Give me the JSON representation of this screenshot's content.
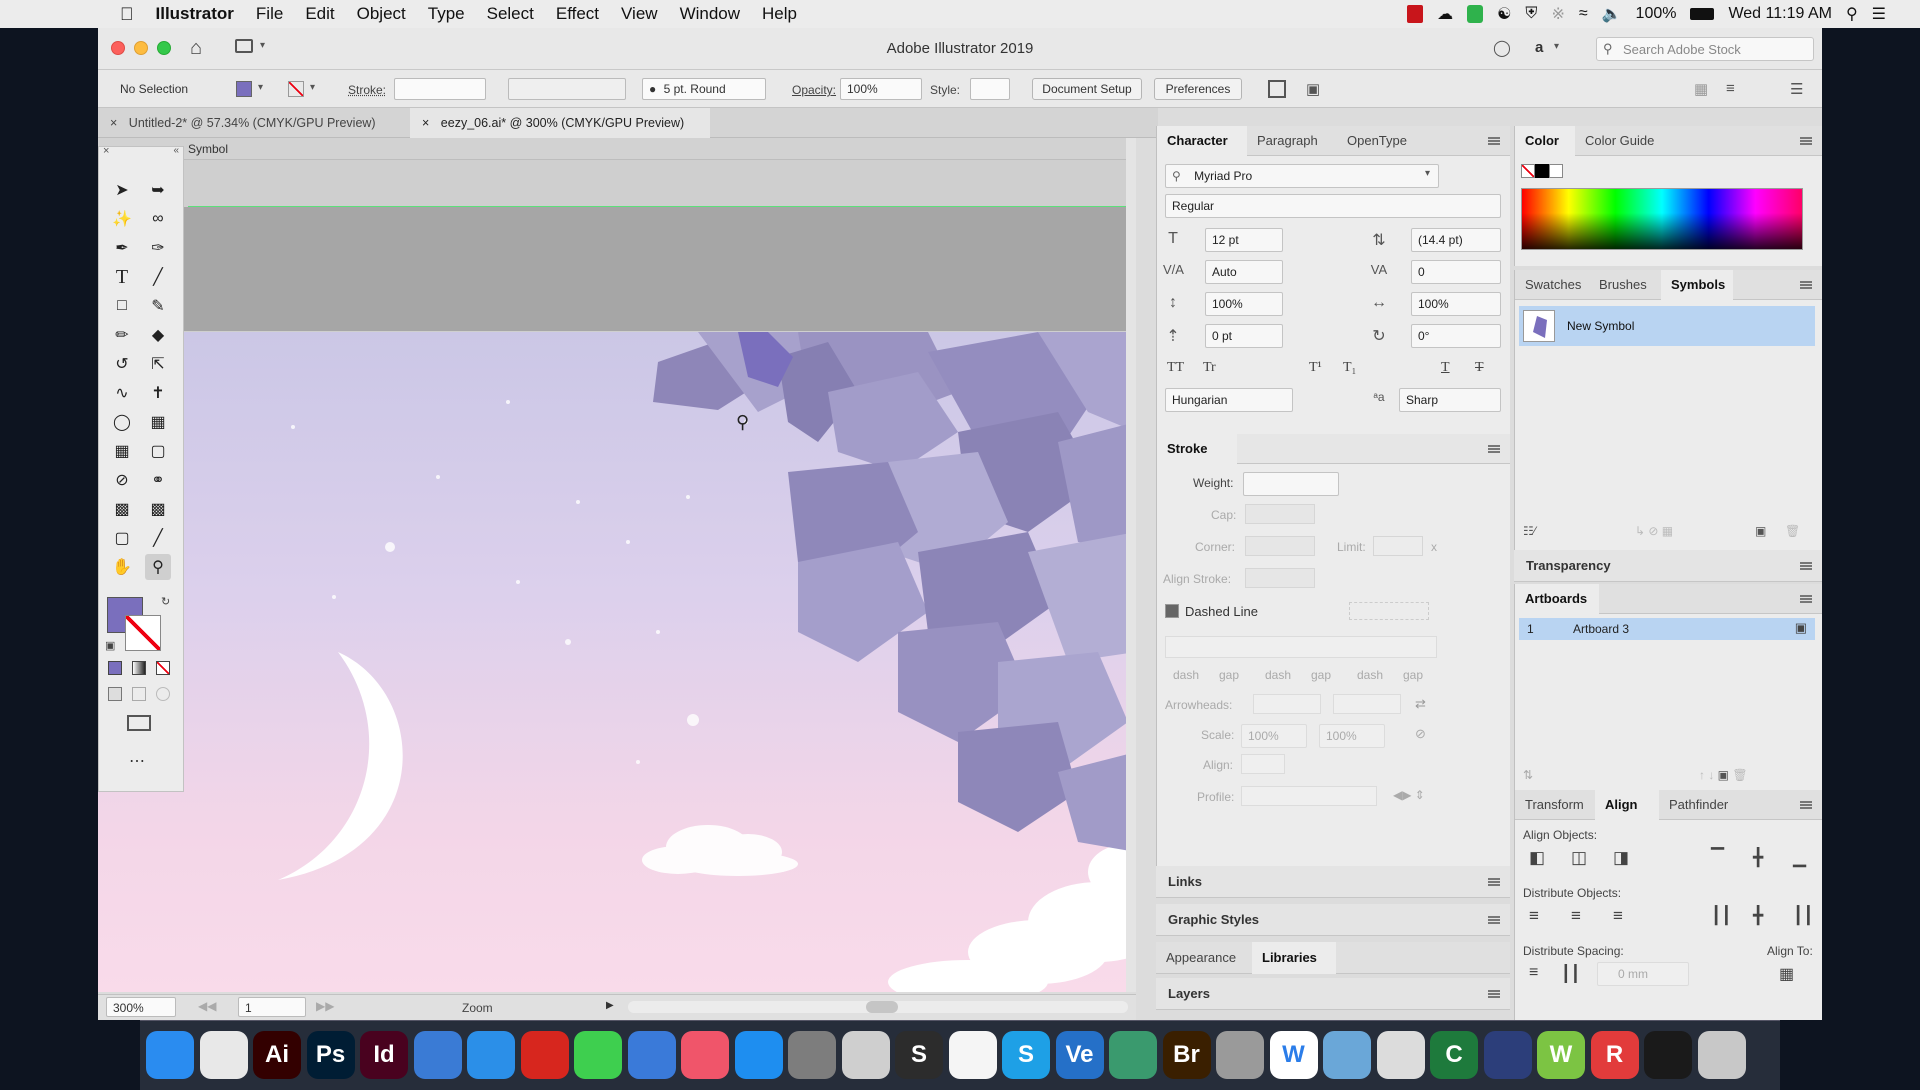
{
  "menubar": {
    "items": [
      "Illustrator",
      "File",
      "Edit",
      "Object",
      "Type",
      "Select",
      "Effect",
      "View",
      "Window",
      "Help"
    ],
    "battery": "100%",
    "clock": "Wed 11:19 AM"
  },
  "window": {
    "title": "Adobe Illustrator 2019",
    "search_placeholder": "Search Adobe Stock",
    "user_initial": "a"
  },
  "control_bar": {
    "selection": "No Selection",
    "stroke_label": "Stroke:",
    "brush": "5 pt. Round",
    "opacity_label": "Opacity:",
    "opacity_value": "100%",
    "style_label": "Style:",
    "document_setup": "Document Setup",
    "preferences": "Preferences"
  },
  "doc_tabs": [
    {
      "label": "Untitled-2* @ 57.34% (CMYK/GPU Preview)"
    },
    {
      "label": "eezy_06.ai* @ 300% (CMYK/GPU Preview)"
    }
  ],
  "canvas": {
    "mode_label": "Symbol",
    "colors": {
      "sky_top": "#c9c7e6",
      "sky_bottom": "#f7d8e9",
      "leaf_dark": "#8e86b8",
      "leaf_light": "#b3aed4",
      "fill": "#7a6fbd"
    }
  },
  "status_bar": {
    "zoom": "300%",
    "artboard": "1",
    "tool": "Zoom"
  },
  "character_panel": {
    "tabs": [
      "Character",
      "Paragraph",
      "OpenType"
    ],
    "font_family": "Myriad Pro",
    "font_style": "Regular",
    "font_size": "12 pt",
    "leading": "(14.4 pt)",
    "kerning": "Auto",
    "tracking": "0",
    "vertical_scale": "100%",
    "horizontal_scale": "100%",
    "baseline_shift": "0 pt",
    "rotation": "0°",
    "language": "Hungarian",
    "anti_alias": "Sharp"
  },
  "stroke_panel": {
    "title": "Stroke",
    "weight_label": "Weight:",
    "cap_label": "Cap:",
    "corner_label": "Corner:",
    "limit_label": "Limit:",
    "limit_suffix": "x",
    "align_stroke_label": "Align Stroke:",
    "dashed_line_label": "Dashed Line",
    "dash_labels": [
      "dash",
      "gap",
      "dash",
      "gap",
      "dash",
      "gap"
    ],
    "arrowheads_label": "Arrowheads:",
    "scale_label": "Scale:",
    "scale_value_1": "100%",
    "scale_value_2": "100%",
    "align_label": "Align:",
    "profile_label": "Profile:"
  },
  "collapsed_panels": [
    "Links",
    "Graphic Styles"
  ],
  "bottom_tabs": [
    "Appearance",
    "Libraries"
  ],
  "layers_label": "Layers",
  "color_panel": {
    "tabs": [
      "Color",
      "Color Guide"
    ]
  },
  "symbols_panel": {
    "tabs": [
      "Swatches",
      "Brushes",
      "Symbols"
    ],
    "items": [
      {
        "name": "New Symbol"
      }
    ]
  },
  "transparency_label": "Transparency",
  "artboards_panel": {
    "title": "Artboards",
    "rows": [
      {
        "index": "1",
        "name": "Artboard 3"
      }
    ]
  },
  "align_panel": {
    "tabs": [
      "Transform",
      "Align",
      "Pathfinder"
    ],
    "align_objects": "Align Objects:",
    "distribute_objects": "Distribute Objects:",
    "distribute_spacing": "Distribute Spacing:",
    "align_to": "Align To:",
    "spacing_value": "0 mm"
  },
  "dock": {
    "apps": [
      {
        "icon": "finder-icon",
        "label": "",
        "color": "#2a8cf0"
      },
      {
        "icon": "chrome-icon",
        "label": "",
        "color": "#e8e8e8"
      },
      {
        "icon": "illustrator-icon",
        "label": "Ai",
        "color": "#330000"
      },
      {
        "icon": "photoshop-icon",
        "label": "Ps",
        "color": "#001d34"
      },
      {
        "icon": "indesign-icon",
        "label": "Id",
        "color": "#49021f"
      },
      {
        "icon": "keynote-icon",
        "label": "",
        "color": "#3a7bd5"
      },
      {
        "icon": "safari-icon",
        "label": "",
        "color": "#2b8fe8"
      },
      {
        "icon": "acrobat-icon",
        "label": "",
        "color": "#d7261e"
      },
      {
        "icon": "messages-icon",
        "label": "",
        "color": "#3ecf4f"
      },
      {
        "icon": "bolt-icon",
        "label": "",
        "color": "#3a7ad9"
      },
      {
        "icon": "music-icon",
        "label": "",
        "color": "#f0556a"
      },
      {
        "icon": "appstore-icon",
        "label": "",
        "color": "#1e8ef0"
      },
      {
        "icon": "settings-icon",
        "label": "",
        "color": "#7d7d7d"
      },
      {
        "icon": "notes-icon",
        "label": "",
        "color": "#cfcfcf"
      },
      {
        "icon": "s-app-icon",
        "label": "S",
        "color": "#2c2c2c"
      },
      {
        "icon": "photos-icon",
        "label": "",
        "color": "#f5f5f5"
      },
      {
        "icon": "skype-icon",
        "label": "S",
        "color": "#1ea0e6"
      },
      {
        "icon": "vectorize-icon",
        "label": "Ve",
        "color": "#2570c8"
      },
      {
        "icon": "drive-icon",
        "label": "",
        "color": "#3a9a6e"
      },
      {
        "icon": "bridge-icon",
        "label": "Br",
        "color": "#3a1f00"
      },
      {
        "icon": "scanner-icon",
        "label": "",
        "color": "#9a9a9a"
      },
      {
        "icon": "w-app-icon",
        "label": "W",
        "color": "#ffffff"
      },
      {
        "icon": "preview-icon",
        "label": "",
        "color": "#6aa7d8"
      },
      {
        "icon": "textedit-icon",
        "label": "",
        "color": "#dcdcdc"
      },
      {
        "icon": "c-app-icon",
        "label": "C",
        "color": "#1e7a3c"
      },
      {
        "icon": "quicktime-icon",
        "label": "",
        "color": "#2c3e7a"
      },
      {
        "icon": "w2-app-icon",
        "label": "W",
        "color": "#7cc443"
      },
      {
        "icon": "r-app-icon",
        "label": "R",
        "color": "#e23b3b"
      },
      {
        "icon": "terminal-icon",
        "label": "",
        "color": "#1a1a1a"
      },
      {
        "icon": "trash-icon",
        "label": "",
        "color": "#c8c8c8"
      }
    ]
  }
}
